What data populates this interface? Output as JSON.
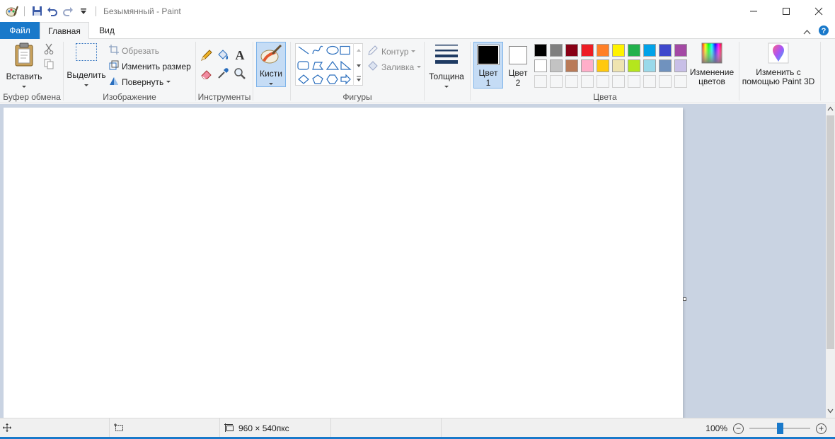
{
  "titlebar": {
    "title": "Безымянный - Paint"
  },
  "menu": {
    "file": "Файл",
    "home": "Главная",
    "view": "Вид"
  },
  "ribbon": {
    "clipboard": {
      "paste": "Вставить",
      "group": "Буфер обмена"
    },
    "image": {
      "select": "Выделить",
      "crop": "Обрезать",
      "resize": "Изменить размер",
      "rotate": "Повернуть",
      "group": "Изображение"
    },
    "tools": {
      "group": "Инструменты"
    },
    "brushes": {
      "label": "Кисти"
    },
    "shapes": {
      "outline": "Контур",
      "fill": "Заливка",
      "group": "Фигуры"
    },
    "size": {
      "label": "Толщина"
    },
    "colors": {
      "color1_label": "Цвет",
      "color1_num": "1",
      "color2_label": "Цвет",
      "color2_num": "2",
      "edit_label_1": "Изменение",
      "edit_label_2": "цветов",
      "group": "Цвета",
      "color1": "#000000",
      "color2": "#ffffff",
      "palette": [
        "#000000",
        "#7f7f7f",
        "#880015",
        "#ed1c24",
        "#ff7f27",
        "#fff200",
        "#22b14c",
        "#00a2e8",
        "#3f48cc",
        "#a349a4",
        "#ffffff",
        "#c3c3c3",
        "#b97a57",
        "#ffaec9",
        "#ffc90e",
        "#efe4b0",
        "#b5e61d",
        "#99d9ea",
        "#7092be",
        "#c8bfe7",
        "",
        "",
        "",
        "",
        "",
        "",
        "",
        "",
        "",
        ""
      ]
    },
    "paint3d": {
      "line1": "Изменить с",
      "line2": "помощью Paint 3D"
    }
  },
  "status": {
    "dimensions": "960 × 540пкс",
    "zoom": "100%",
    "zoom_fraction": 0.5
  }
}
